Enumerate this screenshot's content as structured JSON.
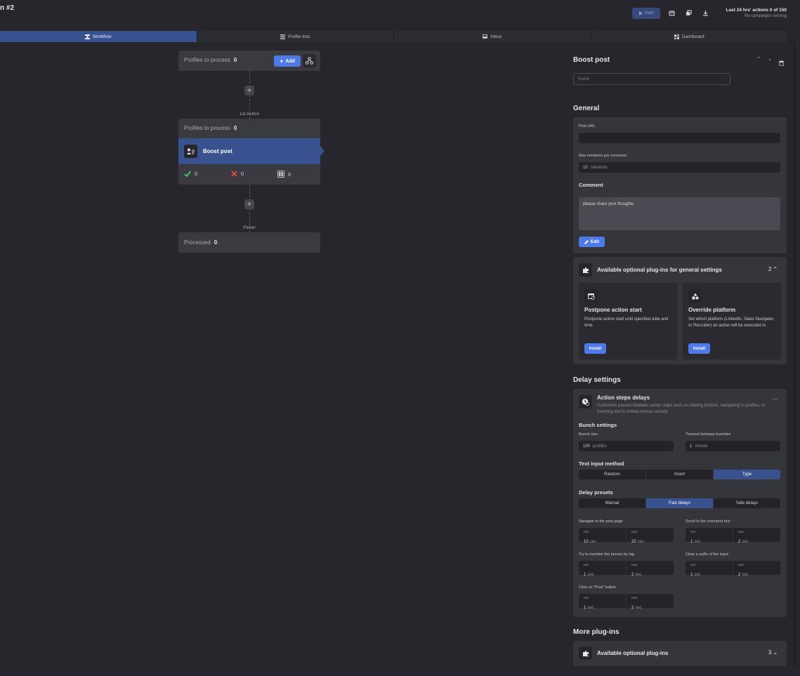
{
  "header": {
    "title": "n #2",
    "start_label": "Start",
    "stats_line1": "Last 24 hrs' actions 0 of 150",
    "stats_line2": "No campaigns running"
  },
  "tabs": [
    {
      "label": "Workflow",
      "icon": "workflow-icon",
      "active": true
    },
    {
      "label": "Profile lists",
      "icon": "list-icon"
    },
    {
      "label": "Inbox",
      "icon": "inbox-icon"
    },
    {
      "label": "Dashboard",
      "icon": "dashboard-icon"
    }
  ],
  "workflow": {
    "start_node": {
      "label": "Profiles to process",
      "count": "0",
      "add_label": "Add"
    },
    "step1_label": "1st Action",
    "action_node": {
      "header_label": "Profiles to process",
      "header_count": "0",
      "name": "Boost post",
      "success_count": "0",
      "failed_count": "0",
      "skipped_count": "0"
    },
    "finish_label": "Finish",
    "finish_node": {
      "label": "Processed",
      "count": "0"
    }
  },
  "panel": {
    "title": "Boost post",
    "name_placeholder": "Name",
    "general": {
      "title": "General",
      "post_url_label": "Post URL",
      "post_url_value": "",
      "max_mentions_label": "Max mentions per comment",
      "max_mentions_value": "10",
      "max_mentions_unit": "mentions",
      "comment_label": "Comment",
      "comment_value": "please share your thoughts",
      "edit_label": "Edit"
    },
    "plugins_general": {
      "title": "Available optional plug-ins for general settings",
      "count": "2",
      "cards": [
        {
          "title": "Postpone action start",
          "desc": "Postpone action start until specified date and time.",
          "install": "Install",
          "icon": "calendar-clock-icon"
        },
        {
          "title": "Override platform",
          "desc": "Set which platform (LinkedIn, Sales Navigator, or Recruiter) an action will be executed in.",
          "install": "Install",
          "icon": "shapes-icon"
        }
      ]
    },
    "delay": {
      "title": "Delay settings",
      "card_title": "Action steps delays",
      "card_desc": "Customize pauses between action steps such as clicking buttons, navigating to profiles, or inserting text to imitate human activity.",
      "bunch_title": "Bunch settings",
      "bunch_size_label": "Bunch size",
      "bunch_size_value": "100",
      "bunch_size_unit": "profiles",
      "timeout_label": "Timeout between bunches",
      "timeout_value": "1",
      "timeout_unit": "minute",
      "text_input_title": "Text input method",
      "text_input_options": [
        "Random",
        "Insert",
        "Type"
      ],
      "text_input_selected": 2,
      "presets_title": "Delay presets",
      "presets_options": [
        "Manual",
        "Fast delays",
        "Safe delays"
      ],
      "presets_selected": 1,
      "min_label": "Min",
      "max_label": "Max",
      "unit": "sec",
      "delays": [
        {
          "label": "Navigate to the post page",
          "min": "10",
          "max": "20"
        },
        {
          "label": "Scroll to the comment box",
          "min": "1",
          "max": "2"
        },
        {
          "label": "Try to mention the person by tag",
          "min": "1",
          "max": "2"
        },
        {
          "label": "Clear a suffix of the input",
          "min": "1",
          "max": "2"
        },
        {
          "label": "Click on \"Post\" button",
          "min": "1",
          "max": "2"
        }
      ]
    },
    "more_plugins": {
      "title": "More plug-ins",
      "row_title": "Available optional plug-ins",
      "count": "3"
    }
  }
}
